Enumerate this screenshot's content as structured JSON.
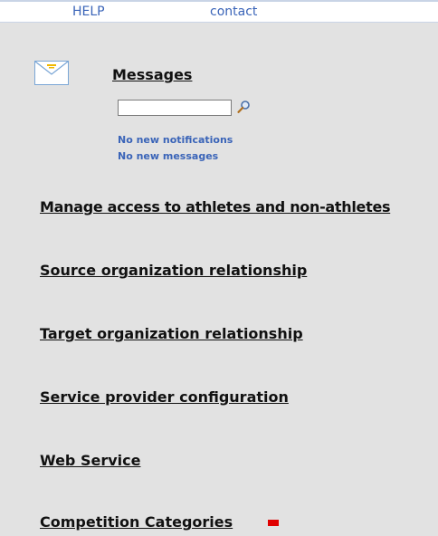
{
  "topbar": {
    "help_label": "HELP",
    "contact_label": "contact"
  },
  "messages": {
    "title": "Messages",
    "search_value": "",
    "notifications_text": "No new notifications",
    "messages_text": "No new messages"
  },
  "nav": {
    "links": [
      "Manage access to athletes and non-athletes",
      "Source organization relationship",
      "Target organization relationship",
      "Service provider configuration",
      "Web Service",
      "Competition Categories"
    ]
  },
  "colors": {
    "link_blue": "#3a64b8",
    "background": "#e2e2e2",
    "marker_red": "#e00000"
  },
  "icons": {
    "envelope": "envelope-icon",
    "search": "magnifier-icon",
    "marker": "red-status-marker"
  }
}
